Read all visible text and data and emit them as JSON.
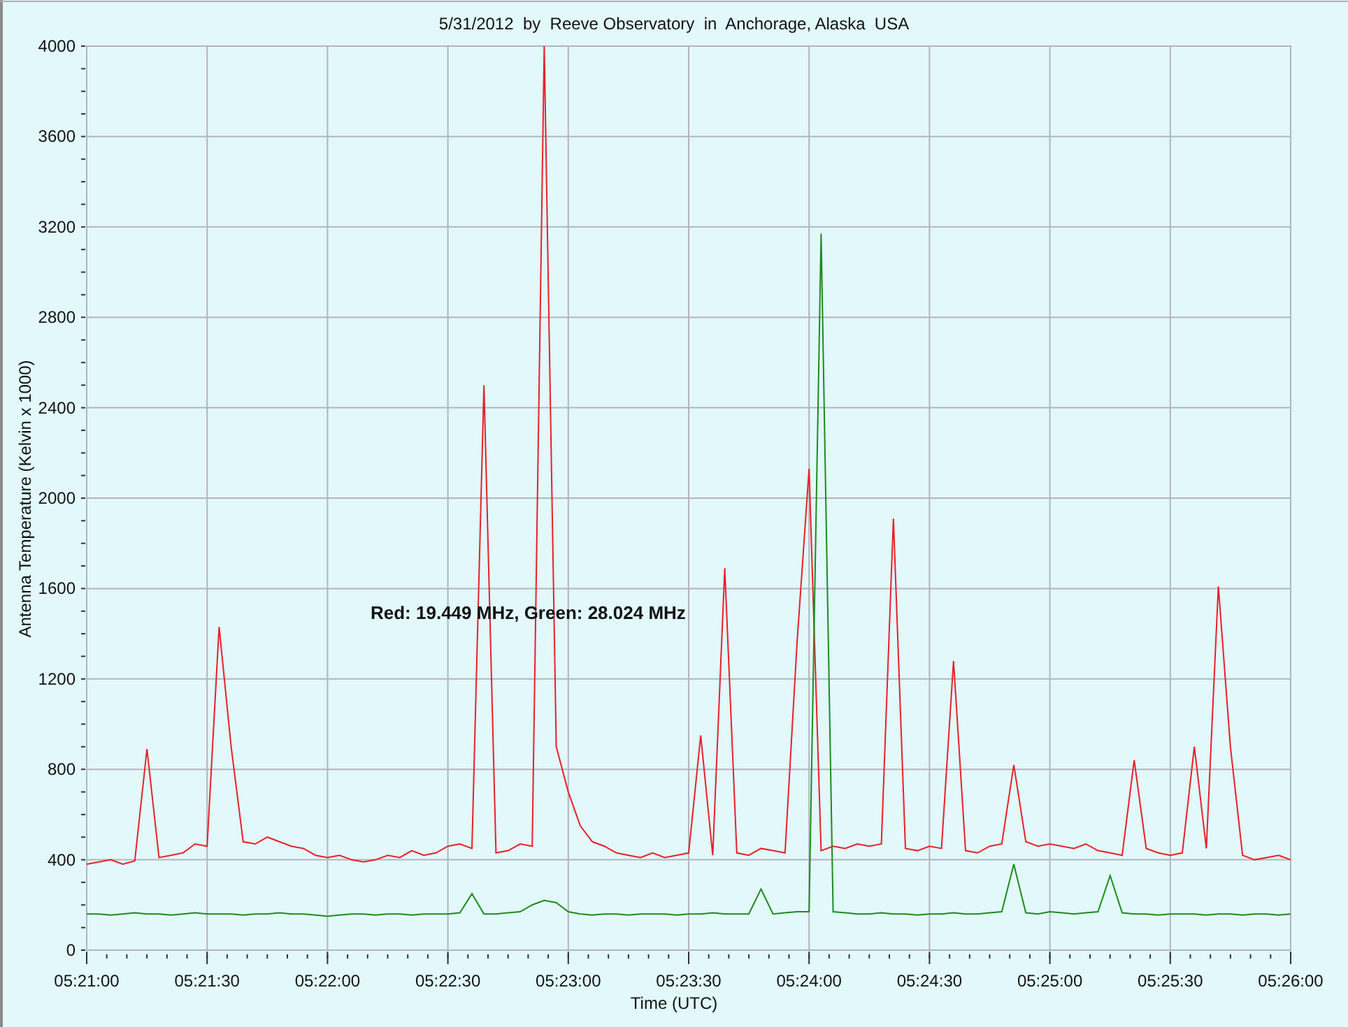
{
  "chart": {
    "chart_data": {
      "type": "line",
      "title": "5/31/2012  by  Reeve Observatory  in  Anchorage, Alaska  USA",
      "xlabel": "Time (UTC)",
      "ylabel": "Antenna Temperature (Kelvin x 1000)",
      "ylim": [
        0,
        4000
      ],
      "grid": true,
      "categories": [
        "05:21:00",
        null,
        null,
        null,
        null,
        null,
        null,
        null,
        null,
        null,
        "05:21:30",
        null,
        null,
        null,
        null,
        null,
        null,
        null,
        null,
        null,
        "05:22:00",
        null,
        null,
        null,
        null,
        null,
        null,
        null,
        null,
        null,
        "05:22:30",
        null,
        null,
        null,
        null,
        null,
        null,
        null,
        null,
        null,
        "05:23:00",
        null,
        null,
        null,
        null,
        null,
        null,
        null,
        null,
        null,
        "05:23:30",
        null,
        null,
        null,
        null,
        null,
        null,
        null,
        null,
        null,
        "05:24:00",
        null,
        null,
        null,
        null,
        null,
        null,
        null,
        null,
        null,
        "05:24:30",
        null,
        null,
        null,
        null,
        null,
        null,
        null,
        null,
        null,
        "05:25:00",
        null,
        null,
        null,
        null,
        null,
        null,
        null,
        null,
        null,
        "05:25:30",
        null,
        null,
        null,
        null,
        null,
        null,
        null,
        null,
        null,
        "05:26:00"
      ],
      "yticks": [
        0,
        400,
        800,
        1200,
        1600,
        2000,
        2400,
        2800,
        3200,
        3600,
        4000
      ],
      "series": [
        {
          "color": "#e8202a",
          "values": [
            380,
            390,
            400,
            380,
            395,
            890,
            410,
            420,
            430,
            470,
            460,
            1430,
            900,
            480,
            470,
            500,
            480,
            460,
            450,
            420,
            410,
            420,
            400,
            390,
            400,
            420,
            410,
            440,
            420,
            430,
            460,
            470,
            450,
            2500,
            430,
            440,
            470,
            460,
            4000,
            900,
            700,
            550,
            480,
            460,
            430,
            420,
            410,
            430,
            410,
            420,
            430,
            950,
            420,
            1690,
            430,
            420,
            450,
            440,
            430,
            1360,
            2130,
            440,
            460,
            450,
            470,
            460,
            470,
            1910,
            450,
            440,
            460,
            450,
            1280,
            440,
            430,
            460,
            470,
            820,
            480,
            460,
            470,
            460,
            450,
            470,
            440,
            430,
            420,
            840,
            450,
            430,
            420,
            430,
            900,
            450,
            1610,
            900,
            420,
            400,
            410,
            420,
            400
          ]
        },
        {
          "color": "#1f8a1f",
          "values": [
            160,
            160,
            155,
            160,
            165,
            160,
            160,
            155,
            160,
            165,
            160,
            160,
            160,
            155,
            160,
            160,
            165,
            160,
            160,
            155,
            150,
            155,
            160,
            160,
            155,
            160,
            160,
            155,
            160,
            160,
            160,
            165,
            250,
            160,
            160,
            165,
            170,
            200,
            220,
            210,
            170,
            160,
            155,
            160,
            160,
            155,
            160,
            160,
            160,
            155,
            160,
            160,
            165,
            160,
            160,
            160,
            270,
            160,
            165,
            170,
            170,
            3170,
            170,
            165,
            160,
            160,
            165,
            160,
            160,
            155,
            160,
            160,
            165,
            160,
            160,
            165,
            170,
            380,
            165,
            160,
            170,
            165,
            160,
            165,
            170,
            330,
            165,
            160,
            160,
            155,
            160,
            160,
            160,
            155,
            160,
            160,
            155,
            160,
            160,
            155,
            160
          ]
        }
      ],
      "annotations": [
        "Red: 19.449 MHz, Green: 28.024 MHz"
      ]
    }
  }
}
